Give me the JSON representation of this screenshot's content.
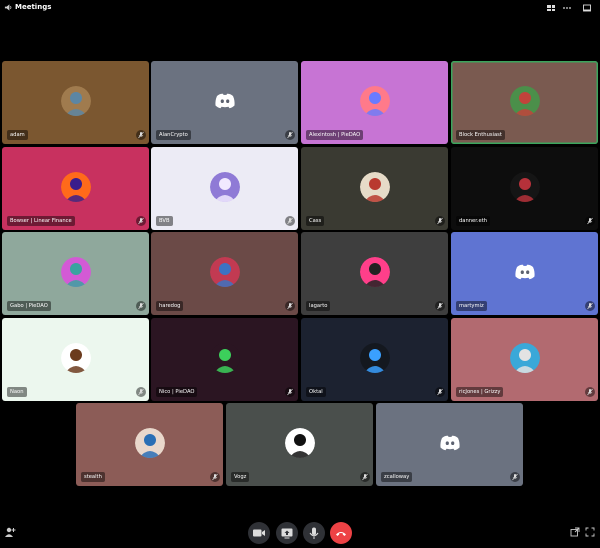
{
  "window": {
    "title": "Meetings"
  },
  "colors": {
    "accent_green": "#3ba55d",
    "hangup_red": "#ed4245",
    "background": "#000000"
  },
  "toolbar": {
    "icons": [
      "volume-icon",
      "grid-layout-icon",
      "more-options-icon",
      "popout-icon"
    ]
  },
  "participants": [
    {
      "name": "adam",
      "bg": "#7b5730",
      "avatar": "#a07b4e",
      "avatar2": "#5c86a3",
      "muted": true
    },
    {
      "name": "AlanCrypto",
      "bg": "#6b7280",
      "avatar": "discord",
      "muted": true
    },
    {
      "name": "Alexintosh | PieDAO",
      "bg": "#c774d4",
      "avatar": "#ff7a8a",
      "avatar2": "#6a7bff",
      "muted": false
    },
    {
      "name": "Block Enthusiast",
      "bg": "#7a5a50",
      "avatar": "#4b8f4a",
      "avatar2": "#c2433b",
      "muted": false,
      "speaking": true
    },
    {
      "name": "Bowser | Linear Finance",
      "bg": "#c8315f",
      "avatar": "#ff6a1a",
      "avatar2": "#3a1d8c",
      "muted": true
    },
    {
      "name": "BVB",
      "bg": "#ecebf5",
      "avatar": "#8f7ad6",
      "avatar2": "#f1e9ff",
      "muted": true
    },
    {
      "name": "Cass",
      "bg": "#3a3a32",
      "avatar": "#e6dbc8",
      "avatar2": "#b93a2f",
      "muted": true
    },
    {
      "name": "danner.eth",
      "bg": "#0d0d0d",
      "avatar": "#151515",
      "avatar2": "#b6313a",
      "muted": true
    },
    {
      "name": "Gabo | PieDAO",
      "bg": "#8fa89c",
      "avatar": "#d35ad5",
      "avatar2": "#3aa3a0",
      "muted": true
    },
    {
      "name": "haredog",
      "bg": "#6b4a47",
      "avatar": "#c23a52",
      "avatar2": "#3c73c2",
      "muted": true
    },
    {
      "name": "lagarto",
      "bg": "#3e3e3e",
      "avatar": "#ff3f8a",
      "avatar2": "#222222",
      "muted": true
    },
    {
      "name": "martymiz",
      "bg": "#5f74d2",
      "avatar": "discord",
      "muted": true
    },
    {
      "name": "Naon",
      "bg": "#ecf7ee",
      "avatar": "#ffffff",
      "avatar2": "#6b3b1d",
      "muted": true
    },
    {
      "name": "Nico | PieDAO",
      "bg": "#2b1522",
      "avatar": "#2b1522",
      "avatar2": "#3ccf5b",
      "muted": true
    },
    {
      "name": "Oktal",
      "bg": "#1c2230",
      "avatar": "#14181f",
      "avatar2": "#3aa0ff",
      "muted": true
    },
    {
      "name": "ricJones | Grizzy",
      "bg": "#b26a70",
      "avatar": "#3aa8d8",
      "avatar2": "#e3e3e3",
      "muted": true
    },
    {
      "name": "stealth",
      "bg": "#8c5c57",
      "avatar": "#e9d8cc",
      "avatar2": "#2a6fb5",
      "muted": true
    },
    {
      "name": "Vogz",
      "bg": "#4a4f4c",
      "avatar": "#ffffff",
      "avatar2": "#111111",
      "muted": true
    },
    {
      "name": "zcalloway",
      "bg": "#6b7280",
      "avatar": "discord",
      "muted": true
    }
  ],
  "controls": {
    "camera": "camera-icon",
    "screenshare": "screenshare-icon",
    "microphone": "microphone-icon",
    "hangup": "hangup-icon",
    "add_person": "add-person-icon",
    "popout": "popout-icon",
    "fullscreen": "fullscreen-icon"
  }
}
